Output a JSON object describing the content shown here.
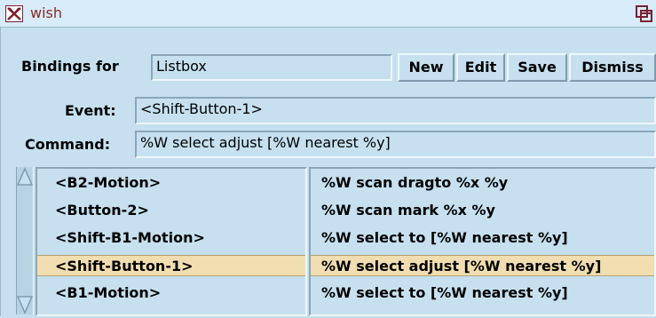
{
  "window": {
    "title": "wish"
  },
  "bindings": {
    "label": "Bindings for",
    "value": "Listbox"
  },
  "buttons": {
    "new": "New",
    "edit": "Edit",
    "save": "Save",
    "dismiss": "Dismiss"
  },
  "event": {
    "label": "Event:",
    "value": "<Shift-Button-1>"
  },
  "command": {
    "label": "Command:",
    "value": "%W select adjust [%W nearest %y]"
  },
  "events_list": [
    "<B2-Motion>",
    "<Button-2>",
    "<Shift-B1-Motion>",
    "<Shift-Button-1>",
    "<B1-Motion>"
  ],
  "commands_list": [
    "%W scan dragto %x %y",
    "%W scan mark %x %y",
    "%W select to [%W nearest %y]",
    "%W select adjust [%W nearest %y]",
    "%W select to [%W nearest %y]"
  ],
  "selected_index": 3,
  "icons": {
    "app": "tk-feather-icon",
    "maximize": "maximize-icon",
    "scroll_up": "scroll-up-arrow-icon",
    "scroll_down": "scroll-down-arrow-icon"
  },
  "colors": {
    "background": "#c6e0ef",
    "selection": "#f0ddb0",
    "title_text": "#8b2a2a"
  }
}
